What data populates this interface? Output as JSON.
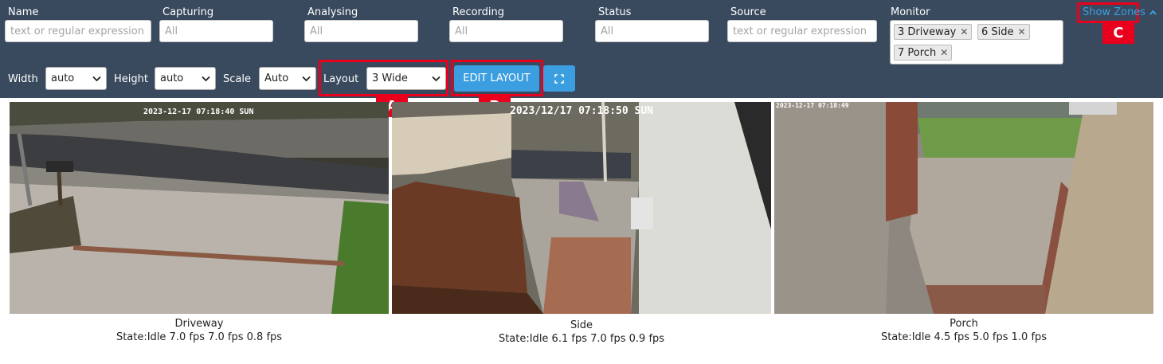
{
  "filters": {
    "name": {
      "label": "Name",
      "placeholder": "text or regular expression"
    },
    "capturing": {
      "label": "Capturing",
      "placeholder": "All"
    },
    "analysing": {
      "label": "Analysing",
      "placeholder": "All"
    },
    "recording": {
      "label": "Recording",
      "placeholder": "All"
    },
    "status": {
      "label": "Status",
      "placeholder": "All"
    },
    "source": {
      "label": "Source",
      "placeholder": "text or regular expression"
    },
    "monitor": {
      "label": "Monitor",
      "selected": [
        "3 Driveway",
        "6 Side",
        "7 Porch"
      ]
    }
  },
  "show_zones": {
    "label": "Show Zones",
    "icon": "chevron-up-icon"
  },
  "layout_controls": {
    "width": {
      "label": "Width",
      "value": "auto"
    },
    "height": {
      "label": "Height",
      "value": "auto"
    },
    "scale": {
      "label": "Scale",
      "value": "Auto"
    },
    "layout": {
      "label": "Layout",
      "value": "3 Wide"
    },
    "edit_layout_label": "EDIT LAYOUT",
    "fullscreen_icon": "fullscreen-icon"
  },
  "annotations": {
    "a": "A",
    "b": "B",
    "c": "C"
  },
  "monitors": [
    {
      "name": "Driveway",
      "status": "State:Idle 7.0 fps 7.0 fps 0.8 fps",
      "timestamp": "2023-12-17 07:18:40 SUN"
    },
    {
      "name": "Side",
      "status": "State:Idle 6.1 fps 7.0 fps 0.9 fps",
      "timestamp": "2023/12/17  07:18:50 SUN"
    },
    {
      "name": "Porch",
      "status": "State:Idle 4.5 fps 5.0 fps 1.0 fps",
      "timestamp": "2023-12-17 07:18:49"
    }
  ],
  "colors": {
    "toolbar_bg": "#394a5e",
    "accent": "#3a9ee0",
    "highlight": "#e8001d",
    "link": "#3c9fe0"
  }
}
